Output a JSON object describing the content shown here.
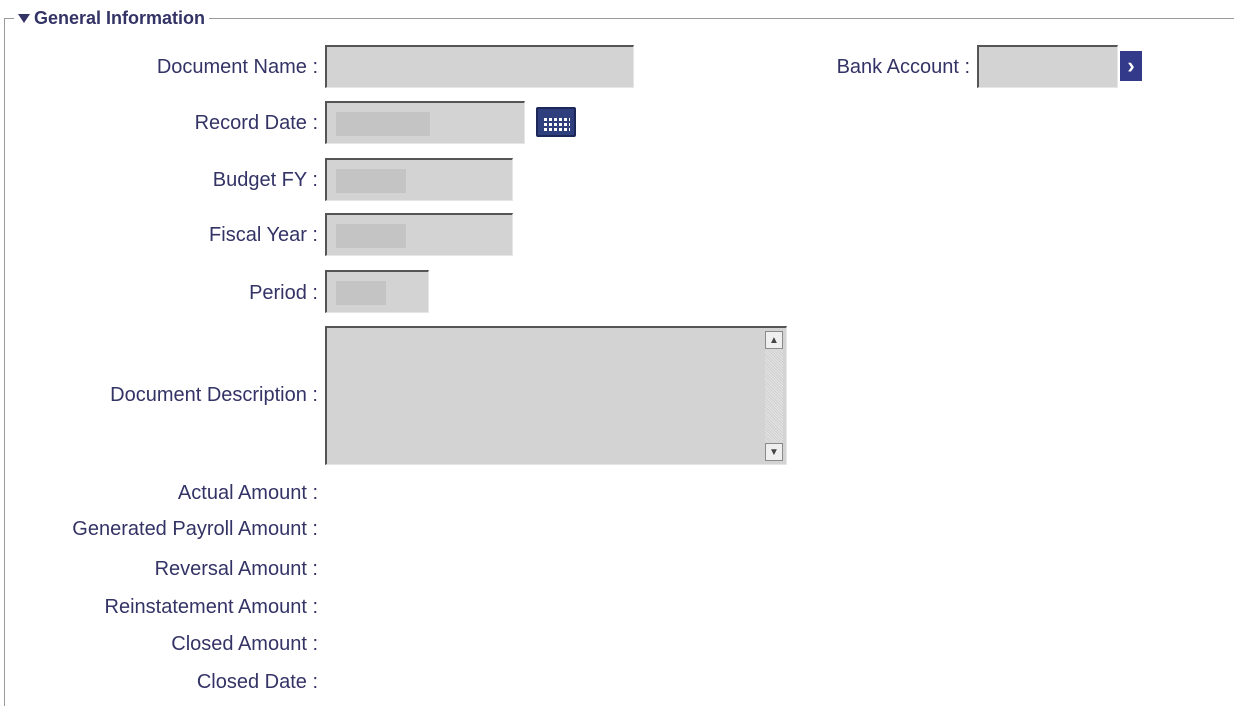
{
  "section": {
    "title": "General Information",
    "expanded": true
  },
  "fields": {
    "document_name": {
      "label": "Document Name :",
      "value": ""
    },
    "bank_account": {
      "label": "Bank Account :",
      "value": ""
    },
    "record_date": {
      "label": "Record Date :",
      "value": ""
    },
    "budget_fy": {
      "label": "Budget FY :",
      "value": ""
    },
    "fiscal_year": {
      "label": "Fiscal Year :",
      "value": ""
    },
    "period": {
      "label": "Period :",
      "value": ""
    },
    "document_description": {
      "label": "Document Description :",
      "value": ""
    }
  },
  "readonly": {
    "actual_amount": {
      "label": "Actual Amount :",
      "value": ""
    },
    "generated_payroll_amount": {
      "label": "Generated Payroll Amount :",
      "value": ""
    },
    "reversal_amount": {
      "label": "Reversal Amount :",
      "value": ""
    },
    "reinstatement_amount": {
      "label": "Reinstatement Amount :",
      "value": ""
    },
    "closed_amount": {
      "label": "Closed Amount :",
      "value": ""
    },
    "closed_date": {
      "label": "Closed Date :",
      "value": ""
    }
  },
  "icons": {
    "collapse": "triangle-down-icon",
    "calendar": "calendar-icon",
    "lookup": "chevron-right-icon",
    "scroll_up": "scroll-up-icon",
    "scroll_down": "scroll-down-icon"
  },
  "colors": {
    "label_text": "#333366",
    "field_bg": "#d3d3d3",
    "accent": "#333a8a"
  }
}
